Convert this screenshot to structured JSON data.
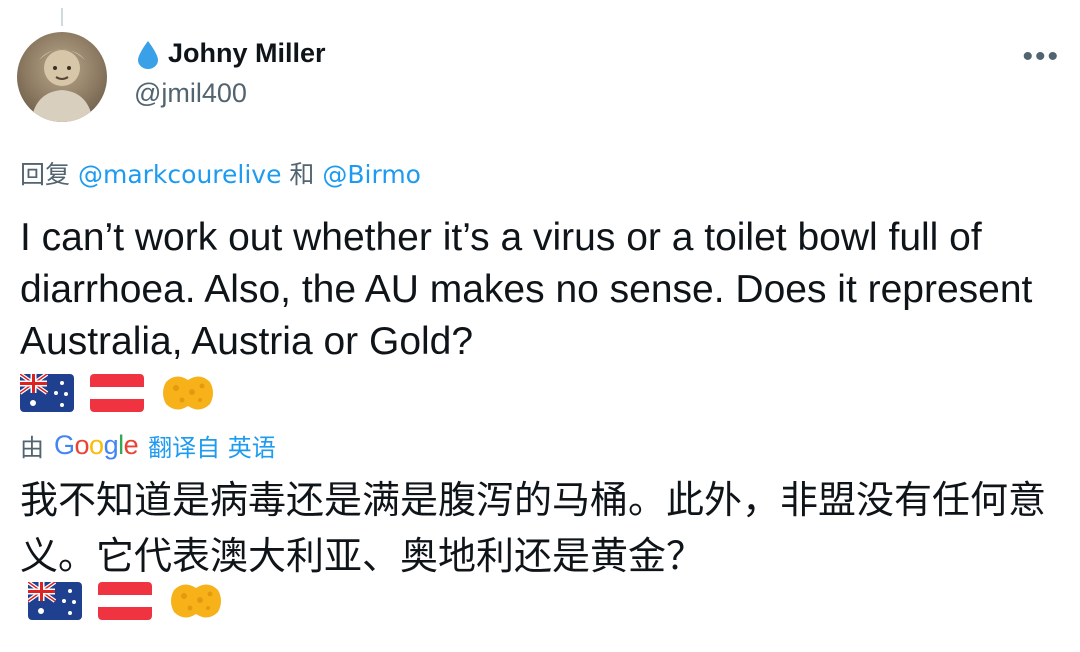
{
  "author": {
    "display_name": "Johny Miller",
    "handle": "@jmil400",
    "name_emoji_icon": "droplet-icon"
  },
  "more_icon": "more-icon",
  "more_label": "•••",
  "reply": {
    "prefix": "回复",
    "mention_1": "@markcourelive",
    "joiner": "和",
    "mention_2": "@Birmo"
  },
  "tweet": {
    "text": "I can’t work out whether it’s a virus or a toilet bowl full of diarrhoea. Also, the AU makes no sense. Does it represent Australia, Austria or Gold?",
    "emojis": [
      "australia-flag-icon",
      "austria-flag-icon",
      "sponge-icon"
    ]
  },
  "translation": {
    "by_label": "由",
    "google_logo": "Google",
    "translated_from": "翻译自 英语",
    "text": "我不知道是病毒还是满是腹泻的马桶。此外，非盟没有任何意义。它代表澳大利亚、奥地利还是黄金？",
    "emojis": [
      "australia-flag-icon",
      "austria-flag-icon",
      "sponge-icon"
    ]
  },
  "colors": {
    "link": "#1d9bf0",
    "secondary_text": "#536471",
    "primary_text": "#0f1419"
  }
}
